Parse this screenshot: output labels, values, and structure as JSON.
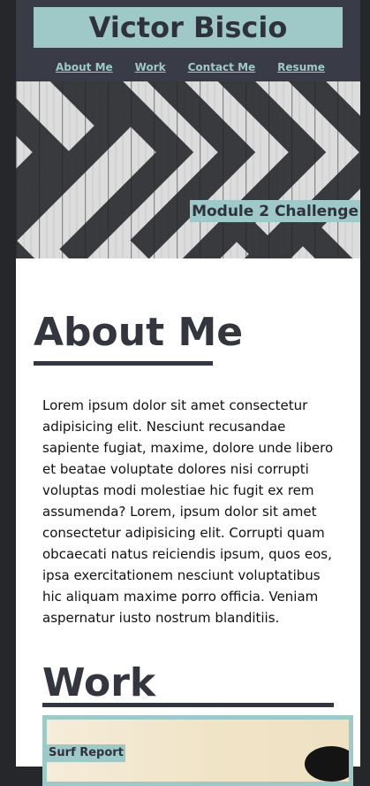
{
  "header": {
    "title": "Victor Biscio",
    "nav": [
      {
        "label": "About Me"
      },
      {
        "label": "Work"
      },
      {
        "label": "Contact Me"
      },
      {
        "label": "Resume"
      }
    ]
  },
  "hero": {
    "label": "Module 2 Challenge"
  },
  "about": {
    "heading": "About Me",
    "text": "Lorem ipsum dolor sit amet consectetur adipisicing elit. Nesciunt recusandae sapiente fugiat, maxime, dolore unde libero et beatae voluptate dolores nisi corrupti voluptas modi molestiae hic fugit ex rem assumenda? Lorem, ipsum dolor sit amet consectetur adipisicing elit. Corrupti quam obcaecati natus reiciendis ipsum, quos eos, ipsa exercitationem nesciunt voluptatibus hic aliquam maxime porro officia. Veniam aspernatur iusto nostrum blanditiis."
  },
  "work": {
    "heading": "Work",
    "card_label": "Surf Report"
  },
  "colors": {
    "accent": "#9fc9c9",
    "header_bg": "#393c47",
    "outer_bg": "#26272b",
    "heading_text": "#33363f"
  }
}
